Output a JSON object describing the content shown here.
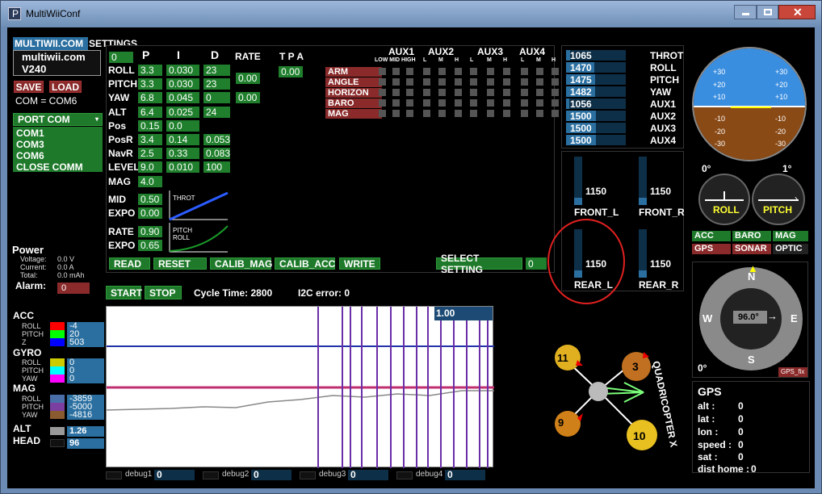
{
  "window": {
    "title": "MultiWiiConf"
  },
  "tabs": [
    "MULTIWII.COM",
    "SETTINGS"
  ],
  "brand": {
    "site": "multiwii.com",
    "version": "V240"
  },
  "file": {
    "save": "SAVE",
    "load": "LOAD",
    "com_status": "COM = COM6"
  },
  "port": {
    "header": "PORT COM",
    "items": [
      "COM1",
      "COM3",
      "COM6",
      "CLOSE COMM"
    ]
  },
  "power": {
    "title": "Power",
    "voltage_label": "Voltage:",
    "voltage": "0.0 V",
    "current_label": "Current:",
    "current": "0.0 A",
    "total_label": "Total:",
    "total": "0.0 mAh",
    "alarm_label": "Alarm:",
    "alarm": "0"
  },
  "pid": {
    "headers": [
      "P",
      "I",
      "D",
      "RATE",
      "T P A"
    ],
    "index": "0",
    "rows": [
      {
        "name": "ROLL",
        "p": "3.3",
        "i": "0.030",
        "d": "23"
      },
      {
        "name": "PITCH",
        "p": "3.3",
        "i": "0.030",
        "d": "23"
      },
      {
        "name": "YAW",
        "p": "6.8",
        "i": "0.045",
        "d": "0"
      },
      {
        "name": "ALT",
        "p": "6.4",
        "i": "0.025",
        "d": "24"
      },
      {
        "name": "Pos",
        "p": "0.15",
        "i": "0.0",
        "d": ""
      },
      {
        "name": "PosR",
        "p": "3.4",
        "i": "0.14",
        "d": "0.053"
      },
      {
        "name": "NavR",
        "p": "2.5",
        "i": "0.33",
        "d": "0.083"
      },
      {
        "name": "LEVEL",
        "p": "9.0",
        "i": "0.010",
        "d": "100"
      },
      {
        "name": "MAG",
        "p": "4.0",
        "i": "",
        "d": ""
      }
    ],
    "rate_rp": "0.00",
    "rate_yaw": "0.00",
    "tpa": "0.00",
    "mid_label": "MID",
    "mid": "0.50",
    "expo_label": "EXPO",
    "expo": "0.00",
    "rate_label": "RATE",
    "rate": "0.90",
    "expo2_label": "EXPO",
    "expo2": "0.65",
    "throt_curve_label": "THROT",
    "pr_curve_label1": "PITCH",
    "pr_curve_label2": "ROLL"
  },
  "aux": {
    "headers": [
      "AUX1",
      "AUX2",
      "AUX3",
      "AUX4"
    ],
    "sub1": "LOW MID HIGH",
    "lmh": [
      "L",
      "M",
      "H"
    ],
    "modes": [
      "ARM",
      "ANGLE",
      "HORIZON",
      "BARO",
      "MAG"
    ]
  },
  "actions": {
    "read": "READ",
    "reset": "RESET",
    "calib_mag": "CALIB_MAG",
    "calib_acc": "CALIB_ACC",
    "write": "WRITE",
    "select": "SELECT SETTING",
    "select_val": "0"
  },
  "run": {
    "start": "START",
    "stop": "STOP",
    "cycle": "Cycle Time: 2800",
    "i2c": "I2C error: 0"
  },
  "rc": [
    {
      "val": "1065",
      "name": "THROT",
      "level": 0.07
    },
    {
      "val": "1470",
      "name": "ROLL",
      "level": 0.47
    },
    {
      "val": "1475",
      "name": "PITCH",
      "level": 0.48
    },
    {
      "val": "1482",
      "name": "YAW",
      "level": 0.48
    },
    {
      "val": "1056",
      "name": "AUX1",
      "level": 0.06
    },
    {
      "val": "1500",
      "name": "AUX2",
      "level": 0.5
    },
    {
      "val": "1500",
      "name": "AUX3",
      "level": 0.5
    },
    {
      "val": "1500",
      "name": "AUX4",
      "level": 0.5
    }
  ],
  "motors": [
    {
      "val": "1150",
      "name": "FRONT_L",
      "level": 0.15
    },
    {
      "val": "1150",
      "name": "FRONT_R",
      "level": 0.15
    },
    {
      "val": "1150",
      "name": "REAR_L",
      "level": 0.15
    },
    {
      "val": "1150",
      "name": "REAR_R",
      "level": 0.15
    }
  ],
  "sensors": {
    "acc": {
      "title": "ACC",
      "roll": "-4",
      "pitch": "20",
      "z": "503"
    },
    "gyro": {
      "title": "GYRO",
      "roll": "0",
      "pitch": "0",
      "yaw": "0"
    },
    "mag": {
      "title": "MAG",
      "roll": "-3859",
      "pitch": "-5000",
      "yaw": "-4816"
    },
    "alt": {
      "title": "ALT",
      "val": "1.26"
    },
    "head": {
      "title": "HEAD",
      "val": "96"
    },
    "labels": {
      "roll": "ROLL",
      "pitch": "PITCH",
      "z": "Z",
      "yaw": "YAW"
    }
  },
  "graph": {
    "scale": "1.00",
    "debug": [
      {
        "label": "debug1",
        "val": "0"
      },
      {
        "label": "debug2",
        "val": "0"
      },
      {
        "label": "debug3",
        "val": "0"
      },
      {
        "label": "debug4",
        "val": "0"
      }
    ]
  },
  "quad": {
    "label": "QUADRICOPTER X",
    "motors": [
      "11",
      "3",
      "9",
      "10"
    ]
  },
  "horizon": {
    "ticks": [
      "+30",
      "+20",
      "+10",
      "-10",
      "-20",
      "-30"
    ],
    "roll_deg": "0°",
    "pitch_deg": "1°",
    "roll": "ROLL",
    "pitch": "PITCH"
  },
  "status_lights": {
    "acc": "ACC",
    "baro": "BARO",
    "mag": "MAG",
    "gps": "GPS",
    "sonar": "SONAR",
    "optic": "OPTIC"
  },
  "compass": {
    "n": "N",
    "e": "E",
    "s": "S",
    "w": "W",
    "heading": "96.0°",
    "zero": "0°",
    "gps_fix": "GPS_fix"
  },
  "gps": {
    "title": "GPS",
    "alt_label": "alt :",
    "alt": "0",
    "lat_label": "lat :",
    "lat": "0",
    "lon_label": "lon :",
    "lon": "0",
    "speed_label": "speed :",
    "speed": "0",
    "sat_label": "sat :",
    "sat": "0",
    "dist_label": "dist home :",
    "dist": "0"
  },
  "colors": {
    "green": "#1f7f2c",
    "red": "#8a2a2a",
    "blue": "#2a6fa0",
    "sky": "#3a8ee0",
    "ground": "#8a4a16"
  }
}
